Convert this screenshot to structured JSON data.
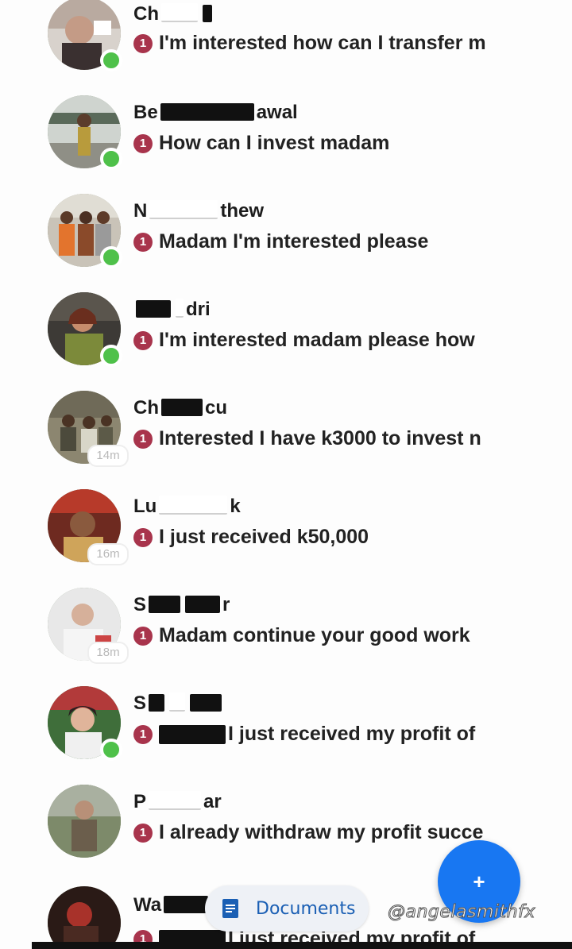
{
  "chats": [
    {
      "name_start": "Ch",
      "name_end": "",
      "message": "I'm interested how can I transfer m",
      "badge": "1",
      "online": true,
      "time": ""
    },
    {
      "name_start": "Be",
      "name_end": "awal",
      "message": "How can I invest madam",
      "badge": "1",
      "online": true,
      "time": ""
    },
    {
      "name_start": "N",
      "name_end": "thew",
      "message": "Madam I'm interested please",
      "badge": "1",
      "online": true,
      "time": ""
    },
    {
      "name_start": "",
      "name_end": "dri",
      "message": "I'm interested madam please how",
      "badge": "1",
      "online": true,
      "time": ""
    },
    {
      "name_start": "Ch",
      "name_end": "cu",
      "message": "Interested I have k3000 to invest n",
      "badge": "1",
      "online": false,
      "time": "14m"
    },
    {
      "name_start": "Lu",
      "name_end": "k",
      "message": "I just received k50,000",
      "badge": "1",
      "online": false,
      "time": "16m"
    },
    {
      "name_start": "S",
      "name_end": "r",
      "message": "Madam continue your good work",
      "badge": "1",
      "online": false,
      "time": "18m"
    },
    {
      "name_start": "S",
      "name_end": "",
      "message": "I just received my profit of",
      "badge": "1",
      "online": true,
      "time": ""
    },
    {
      "name_start": "P",
      "name_end": "ar",
      "message": "I already withdraw my profit succe",
      "badge": "1",
      "online": false,
      "time": ""
    },
    {
      "name_start": "Wa",
      "name_end": "",
      "message": "I just received my profit of",
      "badge": "1",
      "online": false,
      "time": ""
    }
  ],
  "fab": {
    "icon": "plus-icon",
    "label": "+"
  },
  "documents_chip": {
    "label": "Documents",
    "icon": "document-icon"
  },
  "watermark": "@angelasmithfx",
  "colors": {
    "online": "#4fc14a",
    "badge": "#a8344c",
    "fab": "#1877f2",
    "chip_text": "#1a5fb4"
  }
}
